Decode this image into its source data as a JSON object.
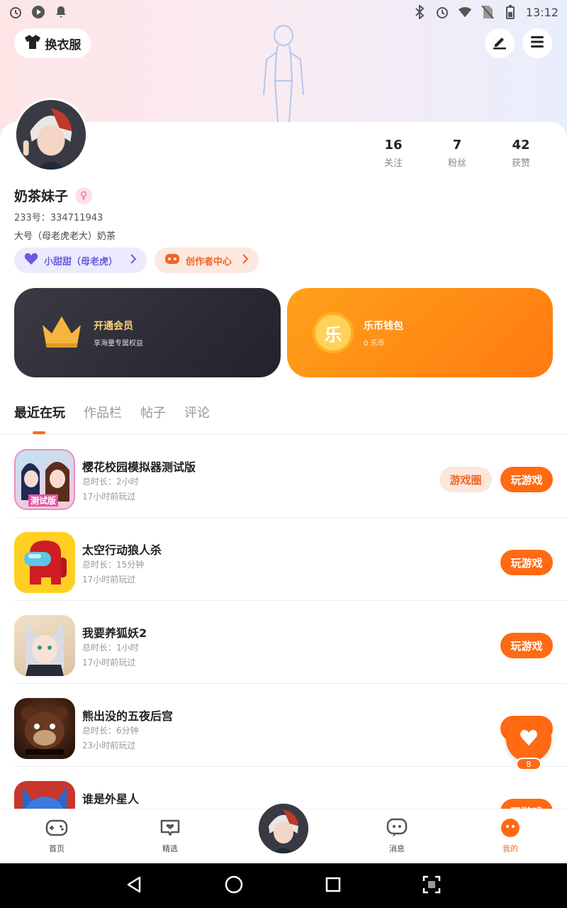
{
  "status_bar": {
    "time": "13:12"
  },
  "header": {
    "costume_label": "换衣服"
  },
  "profile": {
    "name": "奶茶妹子",
    "gender_symbol": "♀",
    "uid_label": "233号",
    "uid": "334711943",
    "bio": "大号（母老虎老大）奶茶",
    "stats": [
      {
        "num": "16",
        "label": "关注"
      },
      {
        "num": "7",
        "label": "粉丝"
      },
      {
        "num": "42",
        "label": "获赞"
      }
    ],
    "pills": {
      "partner": "小甜甜（母老虎）",
      "creator": "创作者中心"
    }
  },
  "cards": {
    "vip": {
      "title": "开通会员",
      "sub": "享海量专属权益"
    },
    "wallet": {
      "title": "乐币钱包",
      "sub": "0 乐币",
      "coin_char": "乐"
    }
  },
  "tabs": [
    "最近在玩",
    "作品栏",
    "帖子",
    "评论"
  ],
  "games": [
    {
      "name": "樱花校园模拟器测试版",
      "duration": "总时长：2小时",
      "last": "17小时前玩过",
      "circle": "游戏圈",
      "play": "玩游戏",
      "icon_text": "测试版"
    },
    {
      "name": "太空行动狼人杀",
      "duration": "总时长：15分钟",
      "last": "17小时前玩过",
      "play": "玩游戏"
    },
    {
      "name": "我要养狐妖2",
      "duration": "总时长：1小时",
      "last": "17小时前玩过",
      "play": "玩游戏"
    },
    {
      "name": "熊出没的五夜后宫",
      "duration": "总时长：6分钟",
      "last": "23小时前玩过",
      "play": "玩游戏"
    },
    {
      "name": "谁是外星人",
      "duration": "",
      "last": "",
      "play": "玩游戏"
    }
  ],
  "fab": {
    "count": "8"
  },
  "bottom_nav": [
    "首页",
    "精选",
    "消息",
    "我的"
  ],
  "colors": {
    "accent": "#ff6a13",
    "vip_gold": "#ffd27a",
    "purple": "#6a5ae0"
  }
}
